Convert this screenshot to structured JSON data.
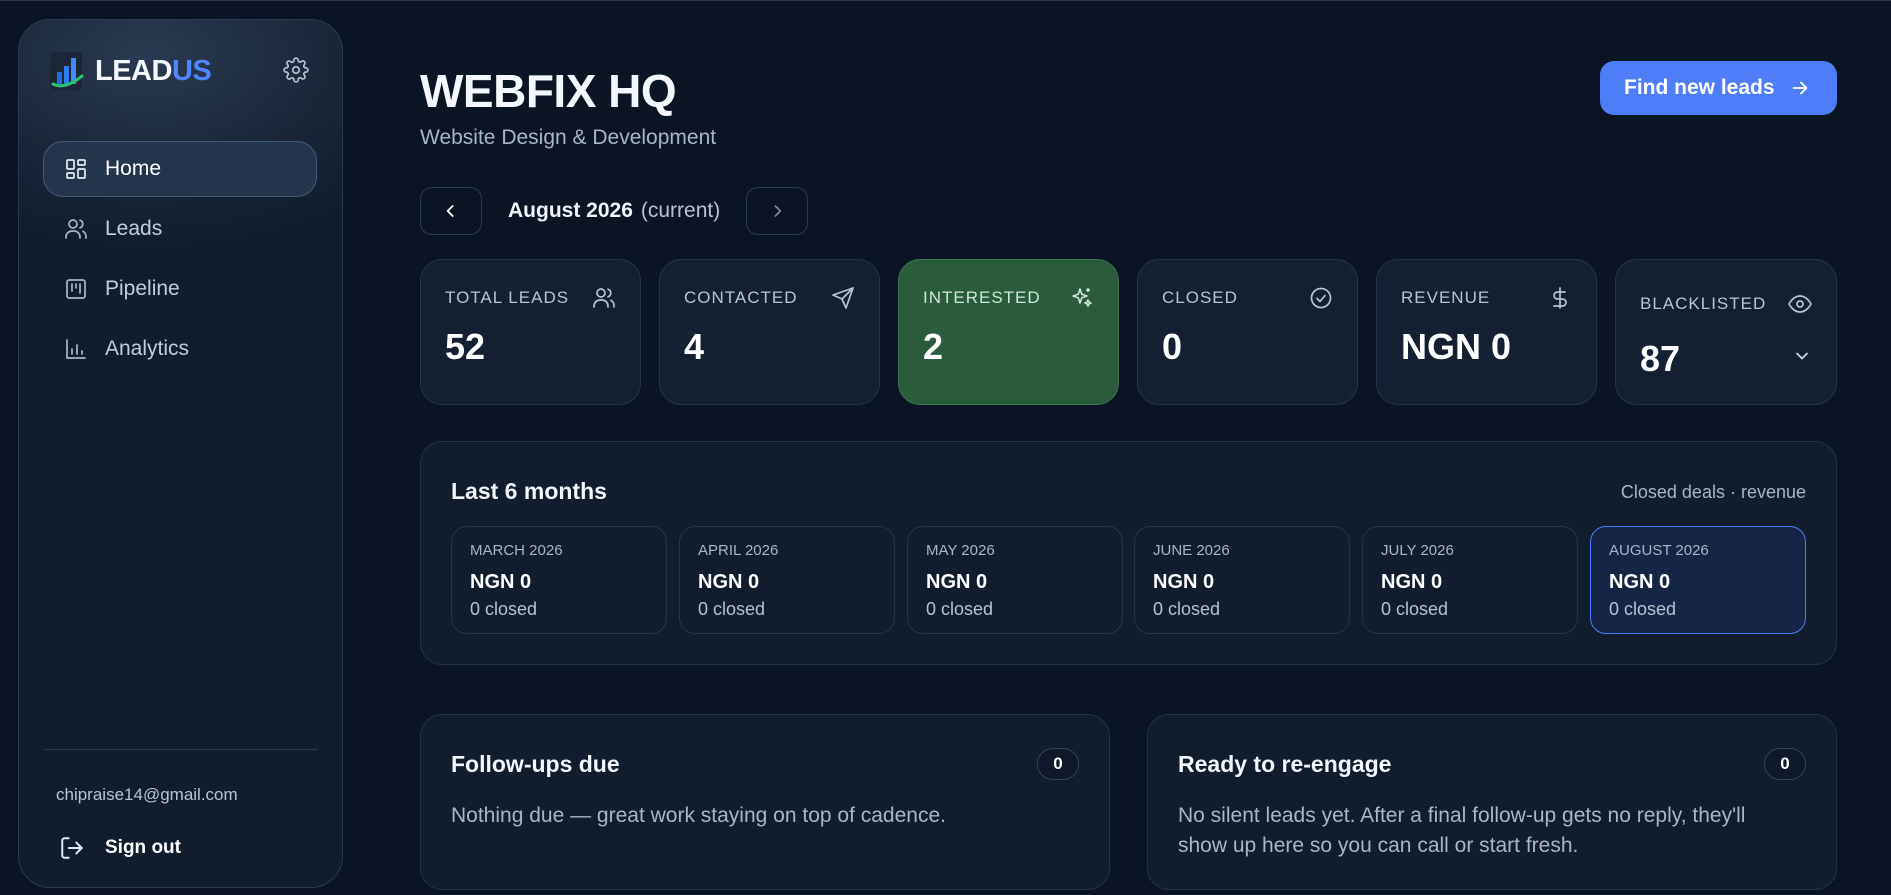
{
  "brand": {
    "name_part1": "LEAD",
    "name_part2": "US",
    "accent": "#4f86ff"
  },
  "sidebar": {
    "items": [
      {
        "label": "Home",
        "icon": "dashboard-grid-icon",
        "active": true
      },
      {
        "label": "Leads",
        "icon": "users-icon",
        "active": false
      },
      {
        "label": "Pipeline",
        "icon": "kanban-icon",
        "active": false
      },
      {
        "label": "Analytics",
        "icon": "bar-chart-icon",
        "active": false
      }
    ],
    "email": "chipraise14@gmail.com",
    "signout_label": "Sign out"
  },
  "header": {
    "title": "WEBFIX HQ",
    "subtitle": "Website Design & Development",
    "find_button": "Find new leads"
  },
  "month_nav": {
    "month": "August 2026",
    "current_tag": "(current)"
  },
  "stats": [
    {
      "label": "TOTAL LEADS",
      "value": "52",
      "icon": "users-icon"
    },
    {
      "label": "CONTACTED",
      "value": "4",
      "icon": "send-icon"
    },
    {
      "label": "INTERESTED",
      "value": "2",
      "icon": "sparkles-icon",
      "color": "#2a5b3d"
    },
    {
      "label": "CLOSED",
      "value": "0",
      "icon": "check-circle-icon"
    },
    {
      "label": "REVENUE",
      "value": "NGN 0",
      "icon": "dollar-icon"
    },
    {
      "label": "BLACKLISTED",
      "value": "87",
      "icon": "eye-icon"
    }
  ],
  "history": {
    "title": "Last 6 months",
    "caption": "Closed deals · revenue",
    "months": [
      {
        "name": "MARCH 2026",
        "value": "NGN 0",
        "closed": "0 closed"
      },
      {
        "name": "APRIL 2026",
        "value": "NGN 0",
        "closed": "0 closed"
      },
      {
        "name": "MAY 2026",
        "value": "NGN 0",
        "closed": "0 closed"
      },
      {
        "name": "JUNE 2026",
        "value": "NGN 0",
        "closed": "0 closed"
      },
      {
        "name": "JULY 2026",
        "value": "NGN 0",
        "closed": "0 closed"
      },
      {
        "name": "AUGUST 2026",
        "value": "NGN 0",
        "closed": "0 closed"
      }
    ]
  },
  "followups": {
    "title": "Follow-ups due",
    "count": "0",
    "text": "Nothing due — great work staying on top of cadence."
  },
  "reengage": {
    "title": "Ready to re-engage",
    "count": "0",
    "text": "No silent leads yet. After a final follow-up gets no reply, they'll show up here so you can call or start fresh."
  }
}
